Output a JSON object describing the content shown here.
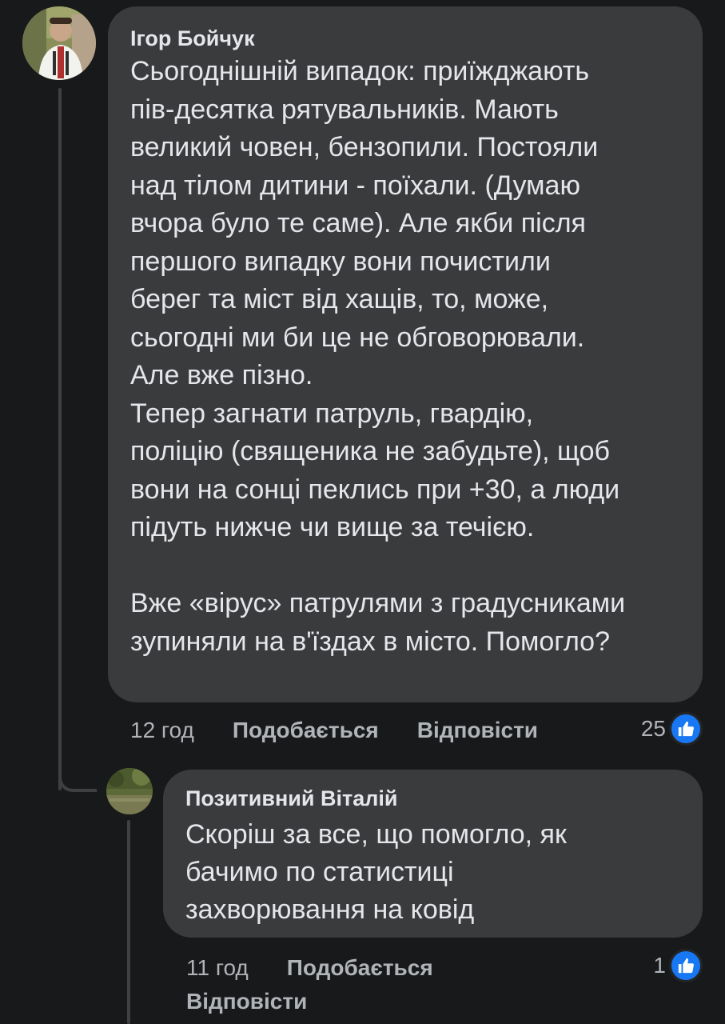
{
  "comment": {
    "author": "Ігор Бойчук",
    "text": "Сьогоднішній випадок: приїжджають\nпів-десятка рятувальників. Мають\nвеликий човен, бензопили. Постояли\nнад тілом дитини - поїхали. (Думаю\nвчора було те саме). Але якби після\nпершого випадку вони почистили\nберег та міст від хащів, то, може,\nсьогодні ми би це не обговорювали.\nАле вже пізно.\nТепер загнати патруль, гвардію,\nполіцію (священика не забудьте), щоб\nвони на сонці пеклись при +30, а люди\nпідуть нижче чи вище за течією.\n\nВже «вірус» патрулями з градусниками\nзупиняли на в'їздах в місто. Помогло?",
    "time": "12 год",
    "like_label": "Подобається",
    "reply_label": "Відповісти",
    "reaction_count": "25"
  },
  "reply": {
    "author": "Позитивний Віталій",
    "text": "Скоріш за все, що помогло, як\nбачимо по статистиці\nзахворювання на ковід",
    "time": "11 год",
    "like_label": "Подобається",
    "reply_label": "Відповісти",
    "reaction_count": "1"
  },
  "colors": {
    "background": "#18191a",
    "bubble": "#3a3b3c",
    "like_blue": "#1877f2"
  },
  "icons": {
    "reaction": "like-thumbs-up-icon"
  }
}
